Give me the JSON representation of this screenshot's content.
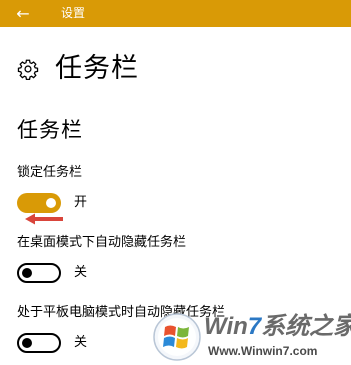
{
  "titlebar": {
    "back_icon": "arrow-left-icon",
    "title": "设置"
  },
  "header": {
    "icon": "gear-icon",
    "title": "任务栏"
  },
  "section": {
    "title": "任务栏"
  },
  "settings": [
    {
      "label": "锁定任务栏",
      "state": "开",
      "on": true
    },
    {
      "label": "在桌面模式下自动隐藏任务栏",
      "state": "关",
      "on": false
    },
    {
      "label": "处于平板电脑模式时自动隐藏任务栏",
      "state": "关",
      "on": false
    }
  ],
  "annotation": {
    "icon": "red-arrow-left-icon",
    "color": "#d9453b"
  },
  "watermark": {
    "brand_prefix": "Win",
    "brand_seven": "7",
    "brand_suffix": "系统之家",
    "url": "Www.Winwin7.com"
  },
  "colors": {
    "accent": "#d99a06",
    "text": "#000000",
    "background": "#ffffff"
  }
}
